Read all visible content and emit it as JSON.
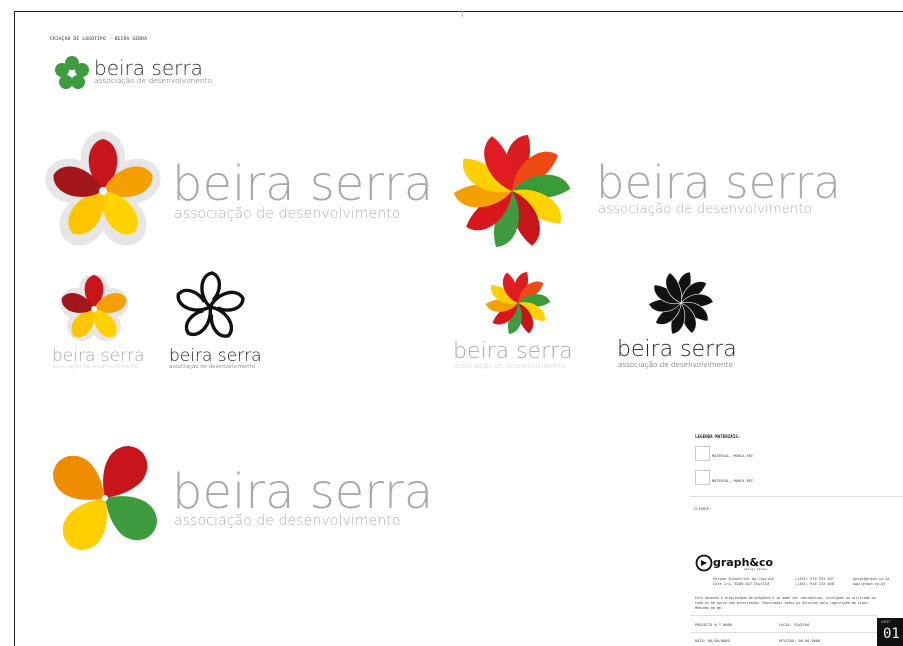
{
  "sheet": {
    "title": "CRIAÇÃO DE LOGÓTIPO - BEIRA SERRA",
    "number": "01",
    "number_label": "SHEET"
  },
  "brand": {
    "name": "beira serra",
    "subtitle": "associação de desenvolvimento",
    "colors": {
      "green": "#3f9b3f",
      "red": "#c8151b",
      "orange": "#f08c00",
      "yellow": "#ffd200",
      "grey_text": "#a8a8a8",
      "black": "#111111"
    }
  },
  "logos": {
    "small_header": {
      "name": "beira serra",
      "subtitle": "associação de desenvolvimento"
    },
    "variant_a_large": {
      "name": "beira serra",
      "subtitle": "associação de desenvolvimento"
    },
    "variant_a_small_color": {
      "name": "beira serra",
      "subtitle": "associação de desenvolvimento"
    },
    "variant_a_small_black": {
      "name": "beira serra",
      "subtitle": "associação de desenvolvimento"
    },
    "variant_b_large": {
      "name": "beira serra",
      "subtitle": "associação de desenvolvimento"
    },
    "variant_b_small_color": {
      "name": "beira serra",
      "subtitle": "associação de desenvolvimento"
    },
    "variant_b_small_black": {
      "name": "beira serra",
      "subtitle": "associação de desenvolvimento"
    },
    "variant_c_large": {
      "name": "beira serra",
      "subtitle": "associação de desenvolvimento"
    }
  },
  "title_block": {
    "legend_heading": "LEGENDA MATERIAIS:",
    "materials": [
      {
        "label": "MATERIAL, MARCA REF."
      },
      {
        "label": "MATERIAL, MARCA REF."
      }
    ],
    "client_label": "CLIENTE:",
    "company": "graph&co",
    "company_tagline": "design studio",
    "address_line1": "Parque Industrial da Covilhã",
    "address_line2": "Lote 1/4, 6200-027 Covilhã",
    "phone_line1": "(+351) 275 333 847",
    "phone_line2": "(+351) 916 213 648",
    "email": "geral@graph.co.pt",
    "web": "www.graph.co.pt",
    "disclaimer_line1": "Este desenho é propriedade da graph&co e só pode ser reproduzido, divulgado ou utilizado no",
    "disclaimer_line2": "todo ou em parte com autorização. Reservados todos os direitos pela legislação em vigor.",
    "disclaimer_line3": "Medidas em mm.",
    "project_label": "PROJECTO N.º 0000",
    "local_label": "LOCAL: COVILHÃ",
    "date_label": "DATA: 00/00/0000",
    "revision_label": "REVISÃO: 00.00.0000"
  }
}
